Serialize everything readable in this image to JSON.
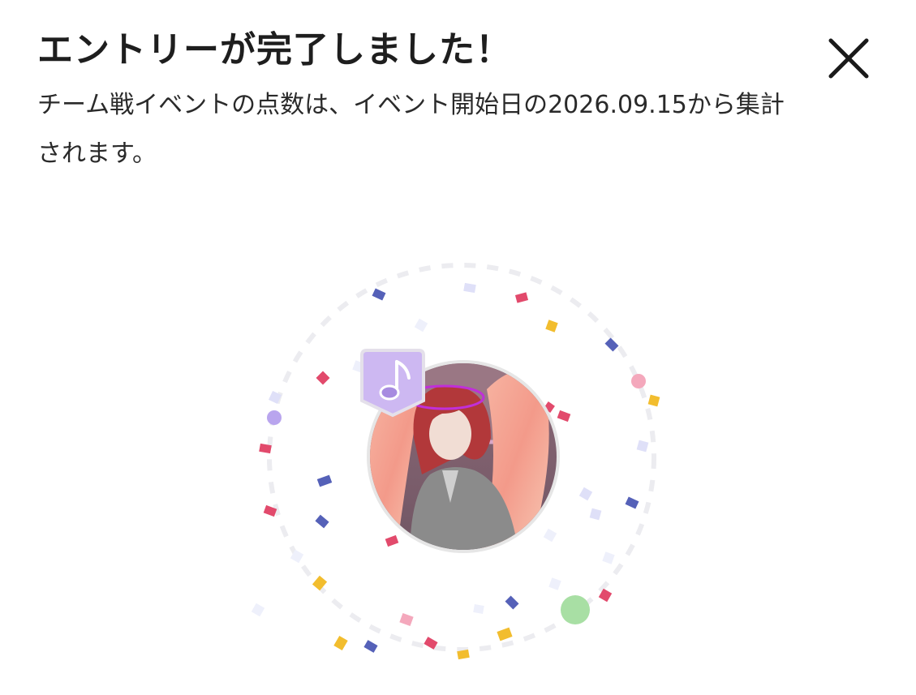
{
  "dialog": {
    "title": "エントリーが完了しました！",
    "description": "チーム戦イベントの点数は、イベント開始日の2026.09.15から集計されます。"
  },
  "close_button": {
    "icon": "close-icon"
  },
  "avatar": {
    "image": "anime-character-avatar",
    "badge_icon": "music-note-icon",
    "colors": {
      "badge": "#cdb8f2",
      "ring": "#e6e6e6",
      "orbit": "#e9e9ef"
    }
  },
  "confetti_colors": [
    "#e24a6c",
    "#5561b8",
    "#f2bd2e",
    "#dfe0f8",
    "#f4a8bc",
    "#b9a5ee",
    "#a8dfa4"
  ]
}
